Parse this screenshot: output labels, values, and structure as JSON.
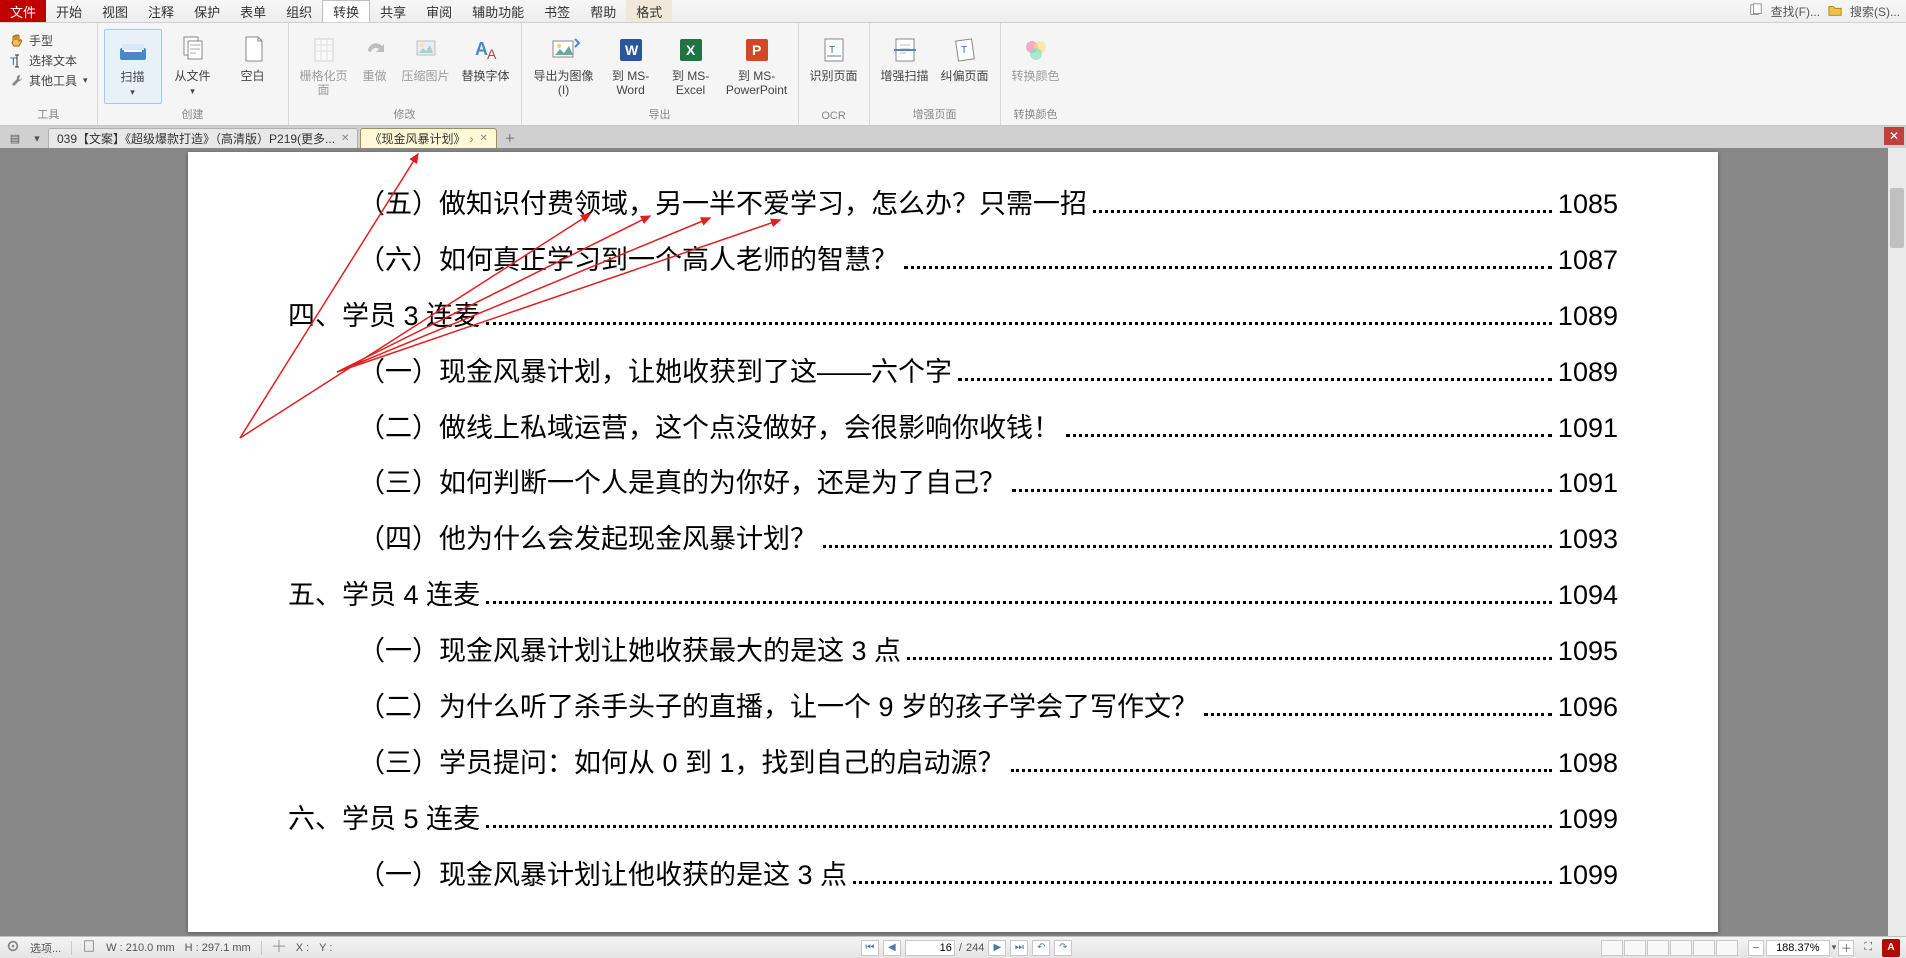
{
  "menu": {
    "file": "文件",
    "start": "开始",
    "view": "视图",
    "annotate": "注释",
    "protect": "保护",
    "form": "表单",
    "organize": "组织",
    "convert": "转换",
    "share": "共享",
    "review": "审阅",
    "accessibility": "辅助功能",
    "bookmark": "书签",
    "help": "帮助",
    "format": "格式"
  },
  "topright": {
    "find": "查找(F)...",
    "search": "搜索(S)..."
  },
  "ribbon": {
    "tools": {
      "label": "工具",
      "hand": "手型",
      "select": "选择文本",
      "other": "其他工具"
    },
    "create": {
      "label": "创建",
      "scan": "扫描",
      "fromfile": "从文件",
      "blank": "空白"
    },
    "modify": {
      "label": "修改",
      "raster": "栅格化页面",
      "redo": "重做",
      "compress": "压缩图片",
      "replacefont": "替换字体"
    },
    "export": {
      "label": "导出",
      "toimage": "导出为图像(I)",
      "toword": "到 MS-Word",
      "toexcel": "到 MS-Excel",
      "toppt": "到 MS-PowerPoint"
    },
    "ocr": {
      "label": "OCR",
      "recognize": "识别页面"
    },
    "enhance": {
      "label": "增强页面",
      "enhancescan": "增强扫描",
      "deskew": "纠偏页面"
    },
    "color": {
      "label": "转换颜色",
      "convertcolor": "转换颜色"
    }
  },
  "tabs": {
    "t1": "039【文案】《超级爆款打造》（高清版）P219(更多...",
    "t2": "《现金风暴计划》"
  },
  "toc": [
    {
      "lvl": 1,
      "t": "（五）做知识付费领域，另一半不爱学习，怎么办？只需一招",
      "p": "1085"
    },
    {
      "lvl": 1,
      "t": "（六）如何真正学习到一个高人老师的智慧？",
      "p": "1087"
    },
    {
      "lvl": 0,
      "t": "四、学员 3 连麦",
      "p": "1089"
    },
    {
      "lvl": 1,
      "t": "（一）现金风暴计划，让她收获到了这——六个字",
      "p": "1089"
    },
    {
      "lvl": 1,
      "t": "（二）做线上私域运营，这个点没做好，会很影响你收钱！",
      "p": "1091"
    },
    {
      "lvl": 1,
      "t": "（三）如何判断一个人是真的为你好，还是为了自己？",
      "p": "1091"
    },
    {
      "lvl": 1,
      "t": "（四）他为什么会发起现金风暴计划？",
      "p": "1093"
    },
    {
      "lvl": 0,
      "t": "五、学员 4 连麦",
      "p": "1094"
    },
    {
      "lvl": 1,
      "t": "（一）现金风暴计划让她收获最大的是这 3 点",
      "p": "1095"
    },
    {
      "lvl": 1,
      "t": "（二）为什么听了杀手头子的直播，让一个 9 岁的孩子学会了写作文？",
      "p": "1096"
    },
    {
      "lvl": 1,
      "t": "（三）学员提问：如何从 0 到 1，找到自己的启动源？",
      "p": "1098"
    },
    {
      "lvl": 0,
      "t": "六、学员 5 连麦",
      "p": "1099"
    },
    {
      "lvl": 1,
      "t": "（一）现金风暴计划让他收获的是这 3 点",
      "p": "1099"
    }
  ],
  "status": {
    "options": "选项...",
    "w_label": "W :",
    "w_val": "210.0 mm",
    "h_label": "H :",
    "h_val": "297.1 mm",
    "x_label": "X :",
    "y_label": "Y :",
    "page_cur": "16",
    "page_total": "244",
    "zoom": "188.37%"
  }
}
